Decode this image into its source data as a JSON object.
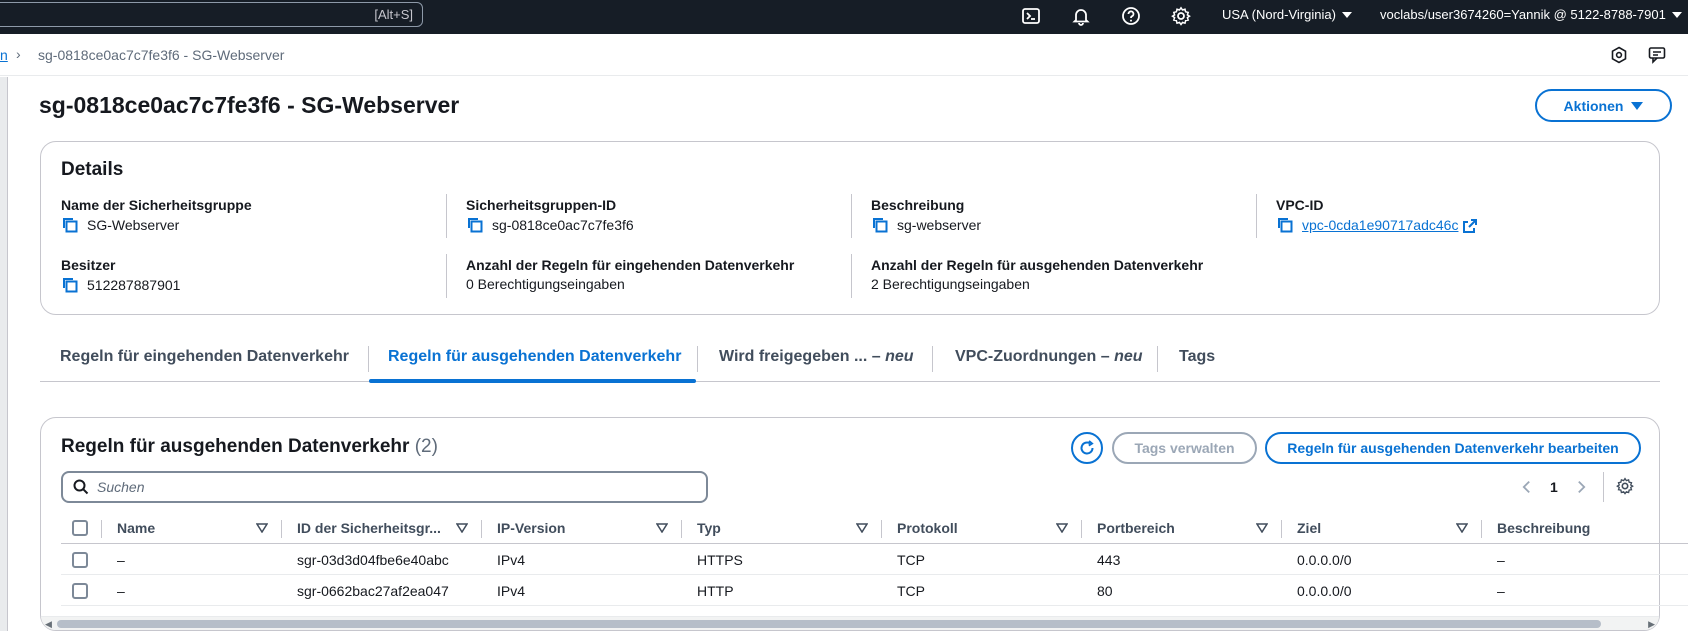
{
  "topbar": {
    "search_shortcut": "[Alt+S]",
    "icons": [
      "cloudshell-icon",
      "bell-icon",
      "help-icon",
      "gear-icon"
    ],
    "region": "USA (Nord-Virginia)",
    "account": "voclabs/user3674260=Yannik @ 5122-8788-7901"
  },
  "breadcrumb": {
    "parent_fragment": "n",
    "current": "sg-0818ce0ac7c7fe3f6 - SG-Webserver"
  },
  "header": {
    "title": "sg-0818ce0ac7c7fe3f6 - SG-Webserver",
    "actions_label": "Aktionen"
  },
  "details": {
    "title": "Details",
    "fields": [
      {
        "label": "Name der Sicherheitsgruppe",
        "value": "SG-Webserver"
      },
      {
        "label": "Sicherheitsgruppen-ID",
        "value": "sg-0818ce0ac7c7fe3f6"
      },
      {
        "label": "Beschreibung",
        "value": "sg-webserver"
      },
      {
        "label": "VPC-ID",
        "value": "vpc-0cda1e90717adc46c"
      },
      {
        "label": "Besitzer",
        "value": "512287887901"
      },
      {
        "label": "Anzahl der Regeln für eingehenden Datenverkehr",
        "value": "0 Berechtigungseingaben"
      },
      {
        "label": "Anzahl der Regeln für ausgehenden Datenverkehr",
        "value": "2 Berechtigungseingaben"
      }
    ]
  },
  "tabs": [
    {
      "label": "Regeln für eingehenden Datenverkehr",
      "suffix": ""
    },
    {
      "label": "Regeln für ausgehenden Datenverkehr",
      "suffix": ""
    },
    {
      "label": "Wird freigegeben ... – ",
      "suffix": "neu"
    },
    {
      "label": "VPC-Zuordnungen – ",
      "suffix": "neu"
    },
    {
      "label": "Tags",
      "suffix": ""
    }
  ],
  "rules": {
    "title": "Regeln für ausgehenden Datenverkehr",
    "count": "(2)",
    "manage_tags_label": "Tags verwalten",
    "edit_label": "Regeln für ausgehenden Datenverkehr bearbeiten",
    "search_placeholder": "Suchen",
    "page": "1",
    "columns": [
      "Name",
      "ID der Sicherheitsgr...",
      "IP-Version",
      "Typ",
      "Protokoll",
      "Portbereich",
      "Ziel",
      "Beschreibung"
    ],
    "rows": [
      [
        "–",
        "sgr-03d3d04fbe6e40abc",
        "IPv4",
        "HTTPS",
        "TCP",
        "443",
        "0.0.0.0/0",
        "–"
      ],
      [
        "–",
        "sgr-0662bac27af2ea047",
        "IPv4",
        "HTTP",
        "TCP",
        "80",
        "0.0.0.0/0",
        "–"
      ]
    ]
  },
  "colors": {
    "accent": "#0972d3",
    "topbar_bg": "#161d26",
    "border": "#c6c6cd"
  }
}
